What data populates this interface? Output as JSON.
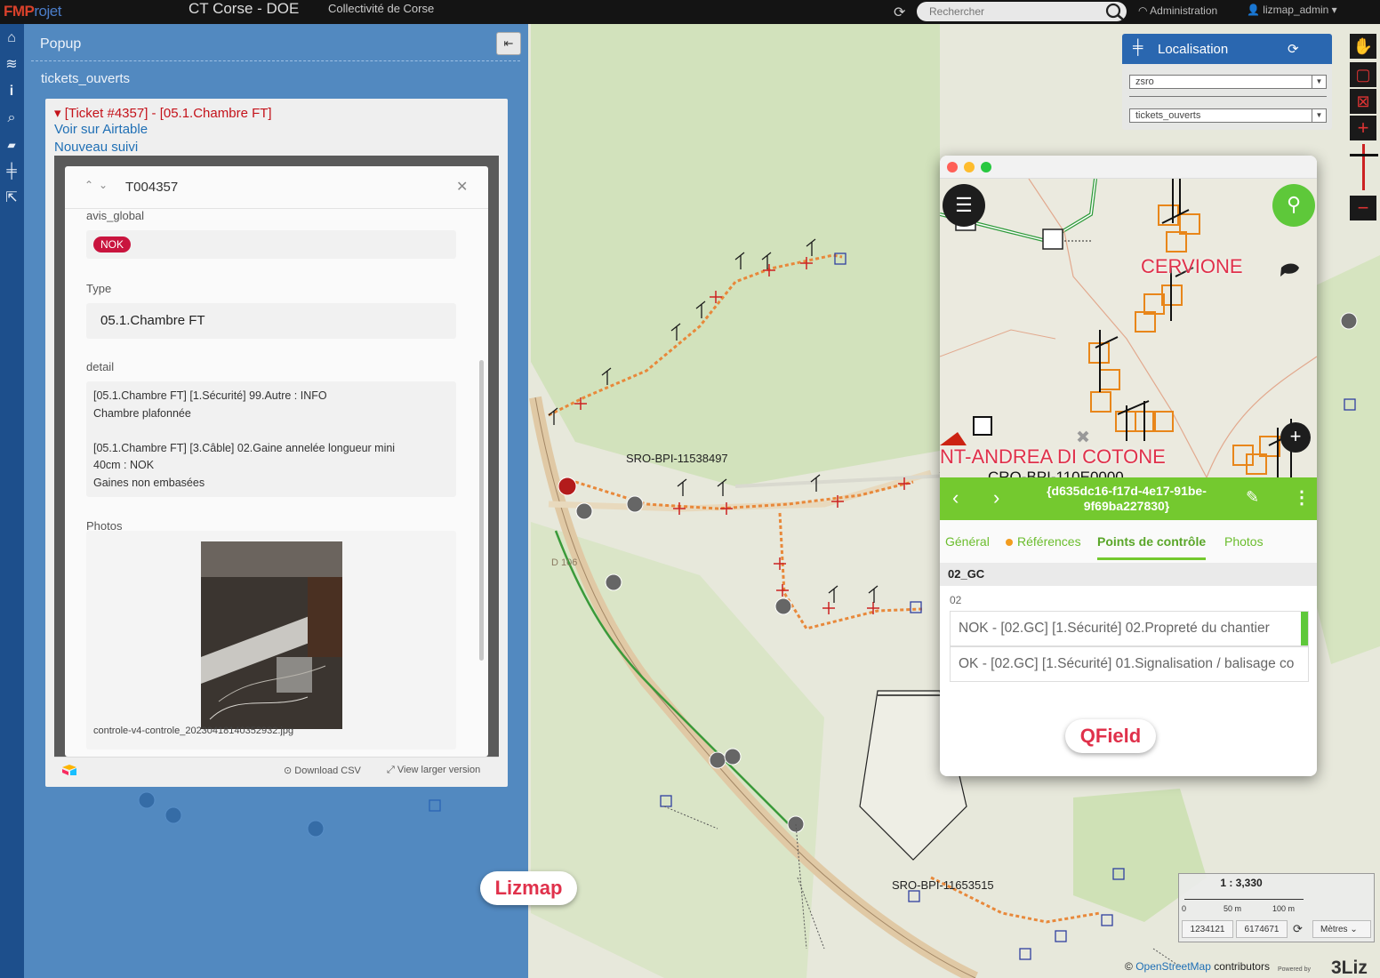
{
  "topbar": {
    "logo": "FMP",
    "logo_suffix": "rojet",
    "title": "CT Corse - DOE",
    "subtitle": "Collectivité de Corse",
    "search_placeholder": "Rechercher",
    "admin": "Administration",
    "user": "lizmap_admin"
  },
  "popup": {
    "title": "Popup",
    "layer": "tickets_ouverts",
    "ticket_title": "[Ticket #4357] - [05.1.Chambre FT]",
    "link_airtable": "Voir sur Airtable",
    "link_suivi": "Nouveau suivi",
    "record": {
      "id": "T004357",
      "avis_label": "avis_global",
      "avis_value": "NOK",
      "type_label": "Type",
      "type_value": "05.1.Chambre FT",
      "detail_label": "detail",
      "detail_value": "[05.1.Chambre FT] [1.Sécurité] 99.Autre : INFO\nChambre plafonnée\n\n[05.1.Chambre FT] [3.Câble] 02.Gaine annelée longueur mini\n40cm : NOK\nGaines non embasées",
      "photos_label": "Photos",
      "photo_filename": "controle-v4-controle_20230418140352932.jpg"
    },
    "download_csv": "Download CSV",
    "view_larger": "View larger version"
  },
  "map": {
    "labels": {
      "sro1": "SRO-BPI-11538497",
      "sro2": "SRO-BPI-11653515",
      "road": "D 106"
    },
    "badge_lizmap": "Lizmap",
    "scale": {
      "ratio": "1 : 3,330",
      "tick0": "0",
      "tick50": "50 m",
      "tick100": "100 m",
      "x": "1234121",
      "y": "6174671",
      "unit": "Mètres"
    },
    "attribution_prefix": "©",
    "attribution_link": "OpenStreetMap",
    "attribution_suffix": "contributors",
    "powered_by": "Powered by",
    "brand": "3Liz"
  },
  "localisation": {
    "title": "Localisation",
    "select1": "zsro",
    "select2": "tickets_ouverts"
  },
  "qfield": {
    "map_labels": {
      "town1": "CERVIONE",
      "town2": "NT-ANDREA DI COTONE",
      "partial": "CRO-BPI-110E0000"
    },
    "feature_id": "{d635dc16-f17d-4e17-91be-9f69ba227830}",
    "tabs": [
      "Général",
      "Références",
      "Points de contrôle",
      "Photos"
    ],
    "section": "02_GC",
    "subsection": "02",
    "rows": [
      "NOK - [02.GC] [1.Sécurité] 02.Propreté du chantier",
      "OK - [02.GC] [1.Sécurité] 01.Signalisation / balisage co"
    ],
    "badge": "QField"
  },
  "colors": {
    "accent_blue": "#2a67b0",
    "qfield_green": "#74c92f",
    "nok_red": "#c9143e",
    "badge_red": "#e0314b"
  }
}
